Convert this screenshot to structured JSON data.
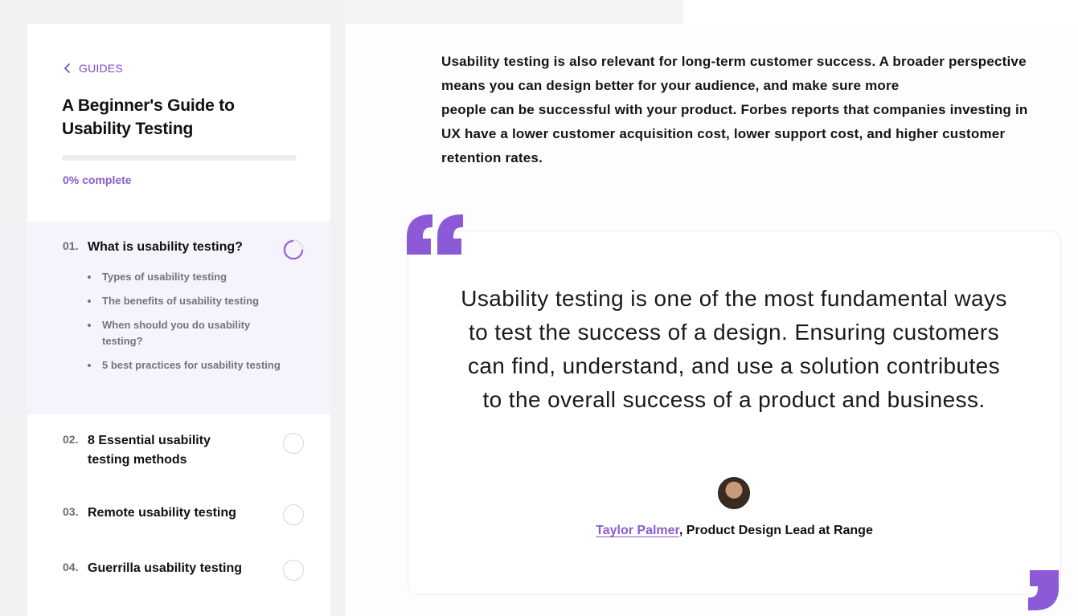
{
  "colors": {
    "accent": "#8c5ad6",
    "accent_text": "#7a4fc9",
    "active_bg": "#f5f3fb"
  },
  "sidebar": {
    "back_label": "GUIDES",
    "guide_title": "A Beginner's Guide to Usability Testing",
    "progress_percent": 0,
    "progress_label": "0% complete",
    "chapters": [
      {
        "num": "01.",
        "title": "What is usability testing?",
        "status": "in-progress"
      },
      {
        "num": "02.",
        "title": "8 Essential usability testing methods",
        "status": "not-started"
      },
      {
        "num": "03.",
        "title": "Remote usability testing",
        "status": "not-started"
      },
      {
        "num": "04.",
        "title": "Guerrilla usability testing",
        "status": "not-started"
      }
    ],
    "subsections": [
      "Types of usability testing",
      "The benefits of usability testing",
      "When should you do usability testing?",
      "5 best practices for usability testing"
    ]
  },
  "main": {
    "paragraph_lines": [
      "Usability testing is also relevant for long-term customer success. A broader perspective means you can design better for your audience, and make sure more",
      "people can be successful with your product. Forbes reports that companies investing in UX have a lower customer acquisition cost, lower support cost, and higher customer retention rates."
    ],
    "quote": {
      "text": "Usability testing is one of the most fundamental ways to test the success of a design. Ensuring customers can find, understand, and use a solution contributes to the overall success of a product and business.",
      "author": "Taylor Palmer",
      "role": ", Product Design Lead at Range"
    }
  },
  "icons": {
    "back": "chevron-left-icon",
    "quote_open": "quote-open-icon",
    "quote_close": "quote-close-icon",
    "progress_ring": "progress-ring-icon"
  }
}
